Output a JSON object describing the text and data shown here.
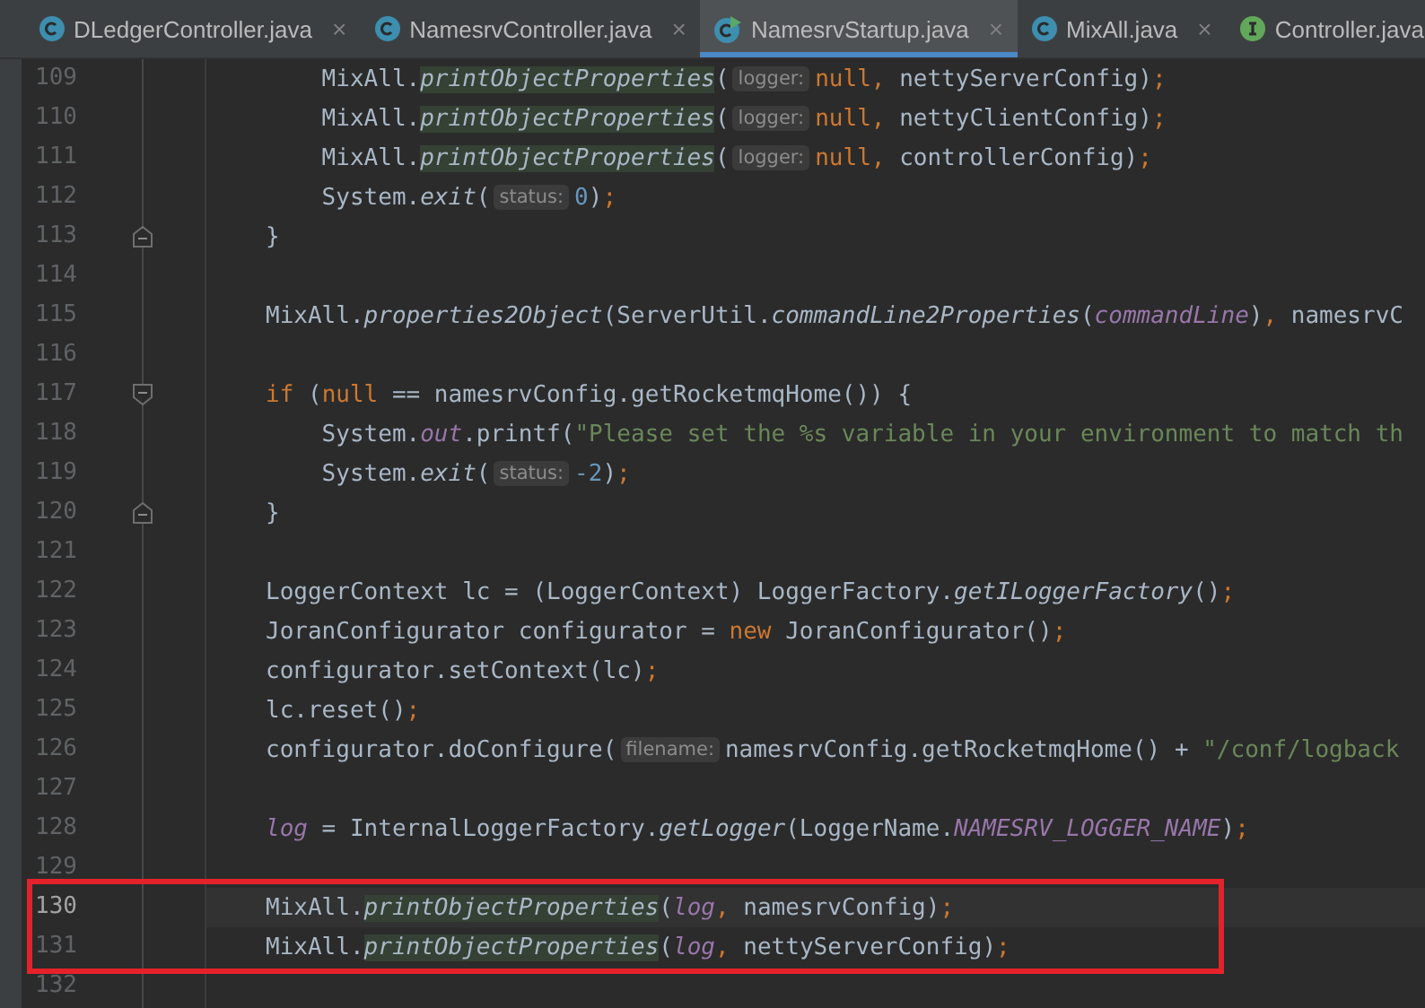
{
  "tabs": [
    {
      "label": "DLedgerController.java",
      "kind": "class",
      "selected": false,
      "close": "×"
    },
    {
      "label": "NamesrvController.java",
      "kind": "class",
      "selected": false,
      "close": "×"
    },
    {
      "label": "NamesrvStartup.java",
      "kind": "runnable",
      "selected": true,
      "close": "×"
    },
    {
      "label": "MixAll.java",
      "kind": "class",
      "selected": false,
      "close": "×"
    },
    {
      "label": "Controller.java",
      "kind": "interface",
      "selected": false
    }
  ],
  "editor": {
    "lines": [
      {
        "number": "109",
        "kind": "code",
        "current": false,
        "boxed": false,
        "tokens": [
          {
            "text": "    MixAll.",
            "kind": "plain"
          },
          {
            "text": "printObjectProperties",
            "kind": "hl"
          },
          {
            "text": "(",
            "kind": "plain"
          },
          {
            "text": "logger:",
            "kind": "hint"
          },
          {
            "text": "null",
            "kind": "kw"
          },
          {
            "text": ",",
            "kind": "punct"
          },
          {
            "text": " nettyServerConfig)",
            "kind": "plain"
          },
          {
            "text": ";",
            "kind": "punct"
          }
        ]
      },
      {
        "number": "110",
        "kind": "code",
        "current": false,
        "boxed": false,
        "tokens": [
          {
            "text": "    MixAll.",
            "kind": "plain"
          },
          {
            "text": "printObjectProperties",
            "kind": "hl"
          },
          {
            "text": "(",
            "kind": "plain"
          },
          {
            "text": "logger:",
            "kind": "hint"
          },
          {
            "text": "null",
            "kind": "kw"
          },
          {
            "text": ",",
            "kind": "punct"
          },
          {
            "text": " nettyClientConfig)",
            "kind": "plain"
          },
          {
            "text": ";",
            "kind": "punct"
          }
        ]
      },
      {
        "number": "111",
        "kind": "code",
        "current": false,
        "boxed": false,
        "tokens": [
          {
            "text": "    MixAll.",
            "kind": "plain"
          },
          {
            "text": "printObjectProperties",
            "kind": "hl"
          },
          {
            "text": "(",
            "kind": "plain"
          },
          {
            "text": "logger:",
            "kind": "hint"
          },
          {
            "text": "null",
            "kind": "kw"
          },
          {
            "text": ",",
            "kind": "punct"
          },
          {
            "text": " controllerConfig)",
            "kind": "plain"
          },
          {
            "text": ";",
            "kind": "punct"
          }
        ]
      },
      {
        "number": "112",
        "kind": "code",
        "current": false,
        "boxed": false,
        "tokens": [
          {
            "text": "    System.",
            "kind": "plain"
          },
          {
            "text": "exit",
            "kind": "static"
          },
          {
            "text": "(",
            "kind": "plain"
          },
          {
            "text": "status:",
            "kind": "hint"
          },
          {
            "text": "0",
            "kind": "num"
          },
          {
            "text": ")",
            "kind": "plain"
          },
          {
            "text": ";",
            "kind": "punct"
          }
        ]
      },
      {
        "number": "113",
        "kind": "block-end",
        "current": false,
        "boxed": false,
        "tokens": [
          {
            "text": "}",
            "kind": "plain"
          }
        ]
      },
      {
        "number": "114",
        "kind": "code",
        "current": false,
        "boxed": false
      },
      {
        "number": "115",
        "kind": "code",
        "current": false,
        "boxed": false,
        "tokens": [
          {
            "text": "MixAll.",
            "kind": "plain"
          },
          {
            "text": "properties2Object",
            "kind": "static"
          },
          {
            "text": "(ServerUtil.",
            "kind": "plain"
          },
          {
            "text": "commandLine2Properties",
            "kind": "static"
          },
          {
            "text": "(",
            "kind": "plain"
          },
          {
            "text": "commandLine",
            "kind": "field"
          },
          {
            "text": ")",
            "kind": "plain"
          },
          {
            "text": ",",
            "kind": "punct"
          },
          {
            "text": " namesrvC",
            "kind": "plain"
          }
        ]
      },
      {
        "number": "116",
        "kind": "code",
        "current": false,
        "boxed": false
      },
      {
        "number": "117",
        "kind": "block-start",
        "current": false,
        "boxed": false,
        "tokens": [
          {
            "text": "if",
            "kind": "kw"
          },
          {
            "text": " (",
            "kind": "plain"
          },
          {
            "text": "null",
            "kind": "kw"
          },
          {
            "text": " == namesrvConfig.getRocketmqHome()) {",
            "kind": "plain"
          }
        ]
      },
      {
        "number": "118",
        "kind": "code",
        "current": false,
        "boxed": false,
        "tokens": [
          {
            "text": "    System.",
            "kind": "plain"
          },
          {
            "text": "out",
            "kind": "field"
          },
          {
            "text": ".printf(",
            "kind": "plain"
          },
          {
            "text": "\"Please set the %s variable in your environment to match th",
            "kind": "str"
          }
        ]
      },
      {
        "number": "119",
        "kind": "code",
        "current": false,
        "boxed": false,
        "tokens": [
          {
            "text": "    System.",
            "kind": "plain"
          },
          {
            "text": "exit",
            "kind": "static"
          },
          {
            "text": "(",
            "kind": "plain"
          },
          {
            "text": "status:",
            "kind": "hint"
          },
          {
            "text": "-2",
            "kind": "num"
          },
          {
            "text": ")",
            "kind": "plain"
          },
          {
            "text": ";",
            "kind": "punct"
          }
        ]
      },
      {
        "number": "120",
        "kind": "block-end",
        "current": false,
        "boxed": false,
        "tokens": [
          {
            "text": "}",
            "kind": "plain"
          }
        ]
      },
      {
        "number": "121",
        "kind": "code",
        "current": false,
        "boxed": false
      },
      {
        "number": "122",
        "kind": "code",
        "current": false,
        "boxed": false,
        "tokens": [
          {
            "text": "LoggerContext lc = (LoggerContext) LoggerFactory.",
            "kind": "plain"
          },
          {
            "text": "getILoggerFactory",
            "kind": "static"
          },
          {
            "text": "()",
            "kind": "plain"
          },
          {
            "text": ";",
            "kind": "punct"
          }
        ]
      },
      {
        "number": "123",
        "kind": "code",
        "current": false,
        "boxed": false,
        "tokens": [
          {
            "text": "JoranConfigurator configurator = ",
            "kind": "plain"
          },
          {
            "text": "new",
            "kind": "kw"
          },
          {
            "text": " JoranConfigurator()",
            "kind": "plain"
          },
          {
            "text": ";",
            "kind": "punct"
          }
        ]
      },
      {
        "number": "124",
        "kind": "code",
        "current": false,
        "boxed": false,
        "tokens": [
          {
            "text": "configurator.setContext(lc)",
            "kind": "plain"
          },
          {
            "text": ";",
            "kind": "punct"
          }
        ]
      },
      {
        "number": "125",
        "kind": "code",
        "current": false,
        "boxed": false,
        "tokens": [
          {
            "text": "lc.reset()",
            "kind": "plain"
          },
          {
            "text": ";",
            "kind": "punct"
          }
        ]
      },
      {
        "number": "126",
        "kind": "code",
        "current": false,
        "boxed": false,
        "tokens": [
          {
            "text": "configurator.doConfigure(",
            "kind": "plain"
          },
          {
            "text": "filename:",
            "kind": "hint"
          },
          {
            "text": "namesrvConfig.getRocketmqHome() + ",
            "kind": "plain"
          },
          {
            "text": "\"/conf/logback",
            "kind": "str"
          }
        ]
      },
      {
        "number": "127",
        "kind": "code",
        "current": false,
        "boxed": false
      },
      {
        "number": "128",
        "kind": "code",
        "current": false,
        "boxed": false,
        "tokens": [
          {
            "text": "log",
            "kind": "field"
          },
          {
            "text": " = InternalLoggerFactory.",
            "kind": "plain"
          },
          {
            "text": "getLogger",
            "kind": "static"
          },
          {
            "text": "(LoggerName.",
            "kind": "plain"
          },
          {
            "text": "NAMESRV_LOGGER_NAME",
            "kind": "field"
          },
          {
            "text": ")",
            "kind": "plain"
          },
          {
            "text": ";",
            "kind": "punct"
          }
        ]
      },
      {
        "number": "129",
        "kind": "code",
        "current": false,
        "boxed": false
      },
      {
        "number": "130",
        "kind": "code",
        "current": true,
        "boxed": true,
        "tokens": [
          {
            "text": "MixAll.",
            "kind": "plain"
          },
          {
            "text": "printObjectProperties",
            "kind": "hl"
          },
          {
            "text": "(",
            "kind": "plain"
          },
          {
            "text": "log",
            "kind": "field"
          },
          {
            "text": ",",
            "kind": "punct"
          },
          {
            "text": " namesrvConfig)",
            "kind": "plain"
          },
          {
            "text": ";",
            "kind": "punct"
          }
        ]
      },
      {
        "number": "131",
        "kind": "code",
        "current": false,
        "boxed": true,
        "tokens": [
          {
            "text": "MixAll.",
            "kind": "plain"
          },
          {
            "text": "printObjectProperties",
            "kind": "hl"
          },
          {
            "text": "(",
            "kind": "plain"
          },
          {
            "text": "log",
            "kind": "field"
          },
          {
            "text": ",",
            "kind": "punct"
          },
          {
            "text": " nettyServerConfig)",
            "kind": "plain"
          },
          {
            "text": ";",
            "kind": "punct"
          }
        ]
      },
      {
        "number": "132",
        "kind": "code",
        "current": false,
        "boxed": false
      }
    ]
  }
}
